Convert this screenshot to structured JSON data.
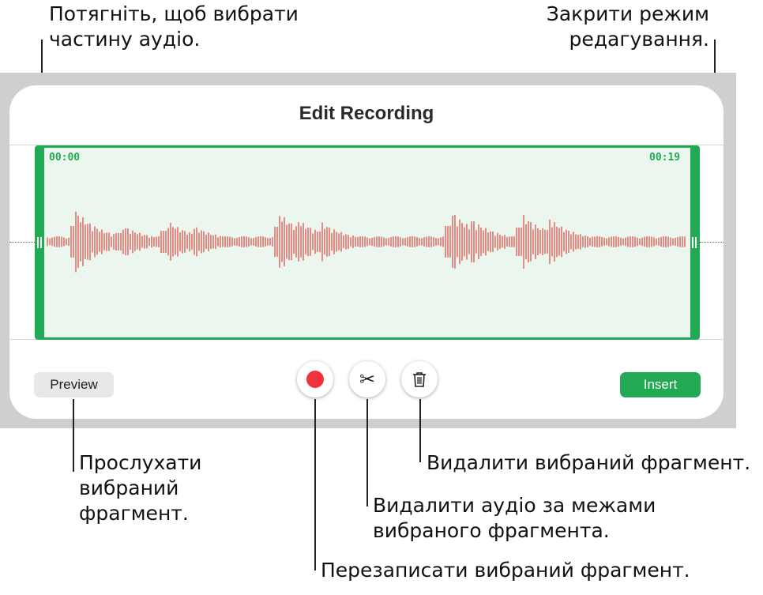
{
  "callouts": {
    "drag_select": "Потягніть, щоб вибрати\nчастину аудіо.",
    "close_edit": "Закрити режим\nредагування.",
    "preview_selection": "Прослухати\nвибраний\nфрагмент.",
    "delete_selection": "Видалити вибраний фрагмент.",
    "trim_outside": "Видалити аудіо за межами\nвибраного фрагмента.",
    "rerecord_selection": "Перезаписати вибраний фрагмент."
  },
  "dialog": {
    "title": "Edit Recording",
    "start_time": "00:00",
    "end_time": "00:19",
    "preview_label": "Preview",
    "insert_label": "Insert"
  },
  "icons": {
    "record": "record-icon",
    "trim": "scissors-icon",
    "delete": "trash-icon"
  },
  "colors": {
    "accent_green": "#22a954",
    "waveform_red": "#e0443e",
    "record_red": "#f2323a"
  }
}
